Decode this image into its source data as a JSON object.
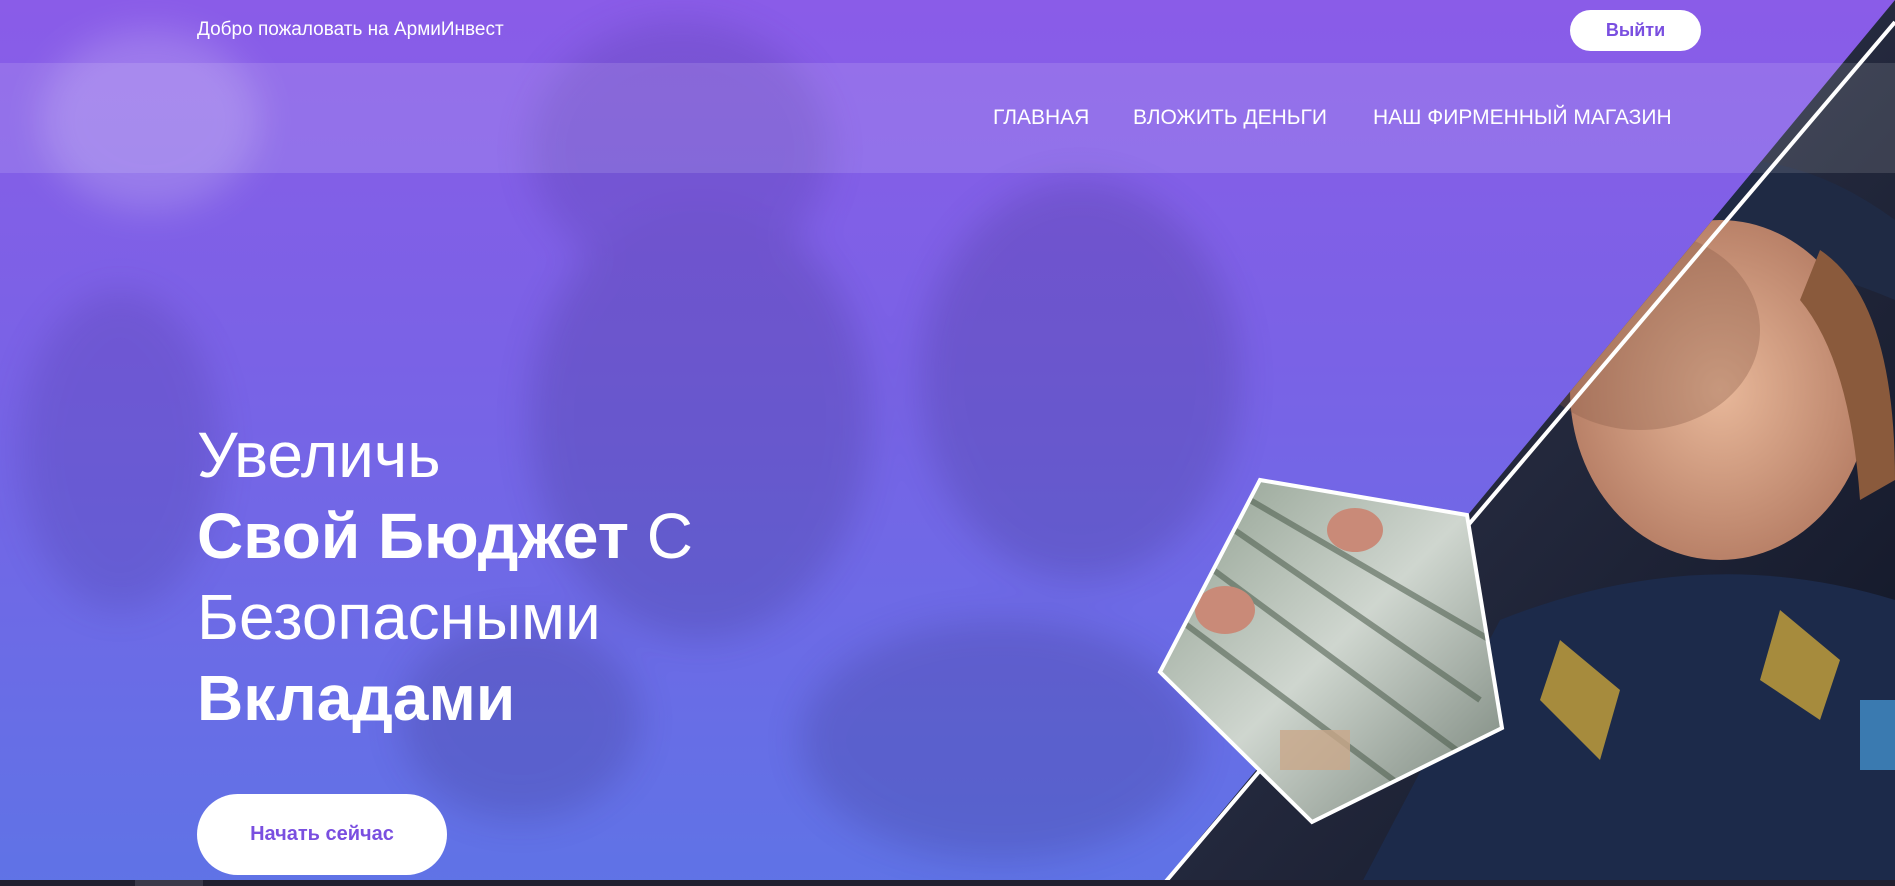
{
  "header": {
    "welcome_text": "Добро пожаловать на АрмиИнвест",
    "logout_label": "Выйти"
  },
  "nav": {
    "items": [
      {
        "label": "ГЛАВНАЯ"
      },
      {
        "label": "ВЛОЖИТЬ ДЕНЬГИ"
      },
      {
        "label": "НАШ ФИРМЕННЫЙ МАГАЗИН"
      }
    ]
  },
  "hero": {
    "line1": "Увеличь",
    "line2_bold": "Свой Бюджет",
    "line2_light": " С",
    "line3": "Безопасными",
    "line4_bold": "Вкладами",
    "cta_label": "Начать сейчас"
  },
  "colors": {
    "accent": "#7a4fe0",
    "gradient_top": "#8a5ce8",
    "gradient_bottom": "#5f73e6"
  },
  "images": {
    "right_photo": "soldier-portrait-photo",
    "inset_photo": "money-banknotes-photo"
  }
}
